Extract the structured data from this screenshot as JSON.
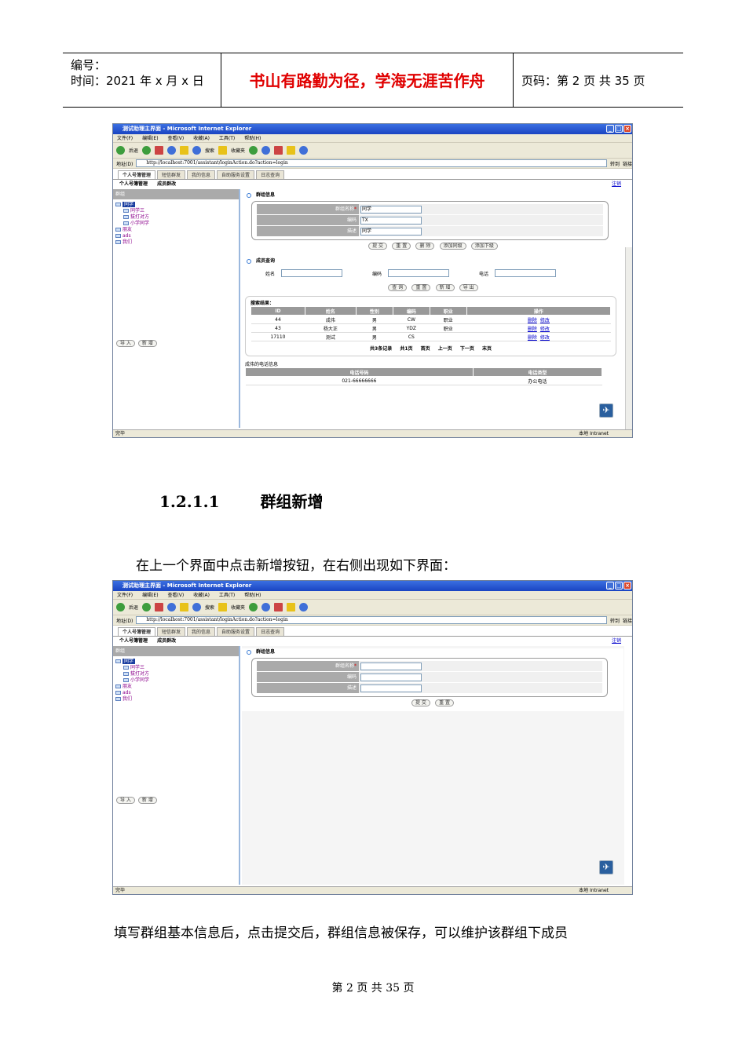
{
  "header": {
    "number_label": "编号：",
    "time_label": "时间：2021 年 x 月 x 日",
    "motto": "书山有路勤为径，学海无涯苦作舟",
    "page_label": "页码：第 2 页  共 35 页"
  },
  "screenshot1": {
    "window_title": "测试助理主界面 - Microsoft Internet Explorer",
    "menu": [
      "文件(F)",
      "编辑(E)",
      "查看(V)",
      "收藏(A)",
      "工具(T)",
      "帮助(H)"
    ],
    "toolbar": {
      "back": "后退",
      "search": "搜索",
      "favorites": "收藏夹"
    },
    "address_label": "地址(D)",
    "address_url": "http://localhost:7001/assistant/loginAction.do?action=login",
    "go": "转到",
    "links": "链接",
    "tabs": [
      "个人号簿管理",
      "短信群发",
      "我的信息",
      "自助服务设置",
      "日志查询"
    ],
    "subtabs": [
      "个人号簿管理",
      "成员群改"
    ],
    "logout": "注销",
    "left_header": "群组",
    "tree_selected": "同学",
    "tree_children": [
      "同学三",
      "拔打对方",
      "小学同学"
    ],
    "tree_root": [
      "朋友",
      "ads",
      "我们"
    ],
    "left_buttons": [
      "导 入",
      "新 增"
    ],
    "group_info_title": "群组信息",
    "field_labels": [
      "群组名称",
      "编码",
      "描述"
    ],
    "field_values": [
      "同学",
      "TX",
      "同学"
    ],
    "group_buttons": [
      "提 交",
      "重 置",
      "删 除",
      "添加同级",
      "添加下级"
    ],
    "member_query_title": "成员查询",
    "query_labels": [
      "姓名",
      "编码",
      "电话"
    ],
    "query_buttons": [
      "查 询",
      "重 置",
      "新 增",
      "导 出"
    ],
    "result_title": "搜索结果：",
    "result_headers": [
      "ID",
      "姓名",
      "性别",
      "编码",
      "职业",
      "操作"
    ],
    "rows": [
      {
        "id": "44",
        "name": "成伟",
        "sex": "男",
        "code": "CW",
        "job": "职业",
        "del": "删除",
        "edit": "修改"
      },
      {
        "id": "43",
        "name": "杨大正",
        "sex": "男",
        "code": "YDZ",
        "job": "职业",
        "del": "删除",
        "edit": "修改"
      },
      {
        "id": "17110",
        "name": "测试",
        "sex": "男",
        "code": "CS",
        "job": "",
        "del": "删除",
        "edit": "修改"
      }
    ],
    "pager": [
      "共3条记录",
      "共1页",
      "首页",
      "上一页",
      "下一页",
      "末页"
    ],
    "phone_title": "成伟的电话信息",
    "phone_headers": [
      "电话号码",
      "电话类型"
    ],
    "phone_partial": [
      "021-66666666",
      "办公电话"
    ],
    "status_left": "完毕",
    "status_zone": "本地 Intranet"
  },
  "heading": {
    "number": "1.2.1.1",
    "title": "群组新增"
  },
  "para1": "在上一个界面中点击新增按钮，在右侧出现如下界面：",
  "screenshot2": {
    "group_buttons": [
      "提 交",
      "重 置"
    ],
    "field_values": [
      "",
      "",
      ""
    ]
  },
  "para2": "填写群组基本信息后，点击提交后，群组信息被保存，可以维护该群组下成员",
  "footer": "第  2  页  共  35  页"
}
